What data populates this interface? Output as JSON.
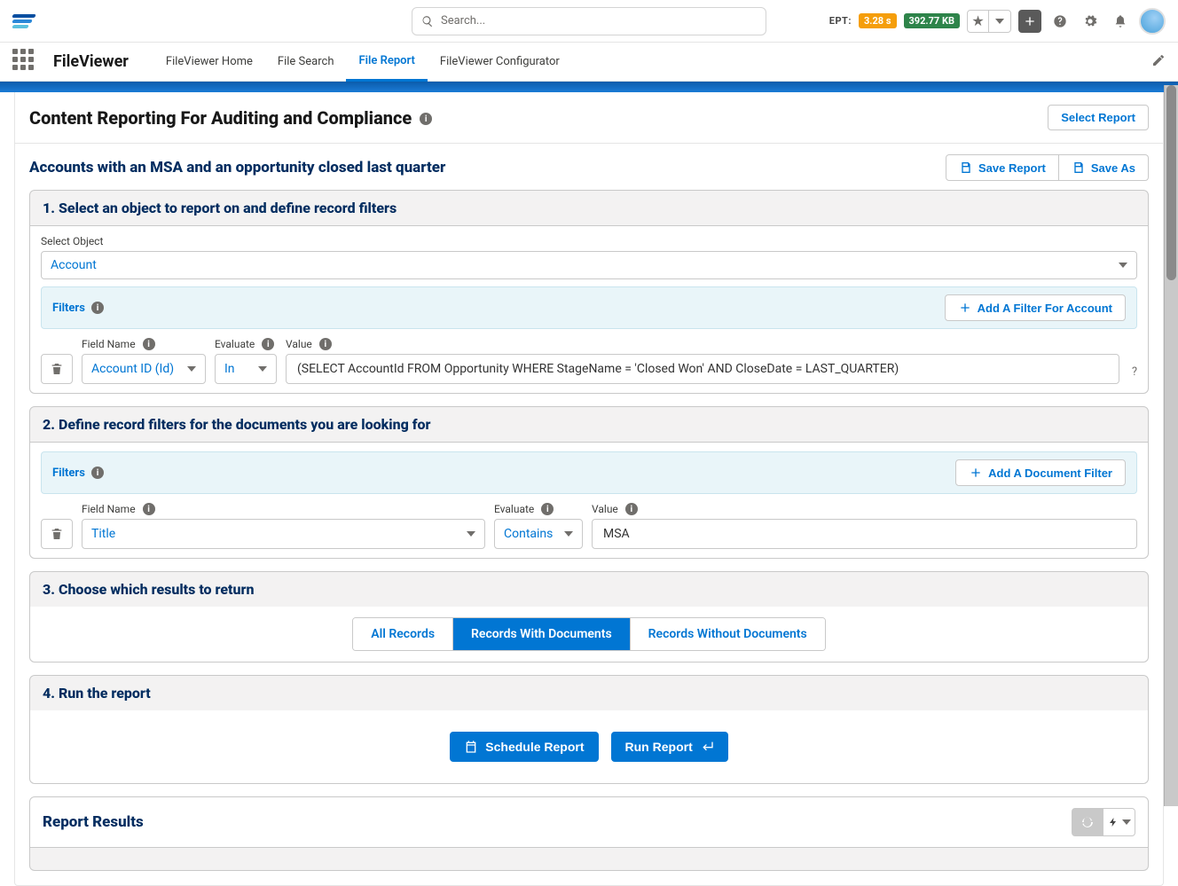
{
  "header": {
    "search_placeholder": "Search...",
    "ept_label": "EPT:",
    "ept_time": "3.28 s",
    "ept_size": "392.77 KB"
  },
  "nav": {
    "app_name": "FileViewer",
    "tabs": [
      {
        "label": "FileViewer Home",
        "active": false
      },
      {
        "label": "File Search",
        "active": false
      },
      {
        "label": "File Report",
        "active": true
      },
      {
        "label": "FileViewer Configurator",
        "active": false
      }
    ]
  },
  "page": {
    "title": "Content Reporting For Auditing and Compliance",
    "select_report": "Select Report",
    "subtitle": "Accounts with an MSA and an opportunity closed last quarter",
    "save_report": "Save Report",
    "save_as": "Save As"
  },
  "section1": {
    "title": "1. Select an object to report on and define record filters",
    "select_object_label": "Select Object",
    "selected_object": "Account",
    "filters_label": "Filters",
    "add_filter": "Add A Filter For Account",
    "row": {
      "field_label": "Field Name",
      "field_value": "Account ID (Id)",
      "evaluate_label": "Evaluate",
      "evaluate_value": "In",
      "value_label": "Value",
      "value_value": "(SELECT AccountId FROM Opportunity WHERE StageName = 'Closed Won' AND CloseDate = LAST_QUARTER)"
    }
  },
  "section2": {
    "title": "2. Define record filters for the documents you are looking for",
    "filters_label": "Filters",
    "add_filter": "Add A Document Filter",
    "row": {
      "field_label": "Field Name",
      "field_value": "Title",
      "evaluate_label": "Evaluate",
      "evaluate_value": "Contains",
      "value_label": "Value",
      "value_value": "MSA"
    }
  },
  "section3": {
    "title": "3. Choose which results to return",
    "options": [
      {
        "label": "All Records",
        "active": false
      },
      {
        "label": "Records With Documents",
        "active": true
      },
      {
        "label": "Records Without Documents",
        "active": false
      }
    ]
  },
  "section4": {
    "title": "4. Run the report",
    "schedule": "Schedule Report",
    "run": "Run Report"
  },
  "results": {
    "title": "Report Results"
  }
}
